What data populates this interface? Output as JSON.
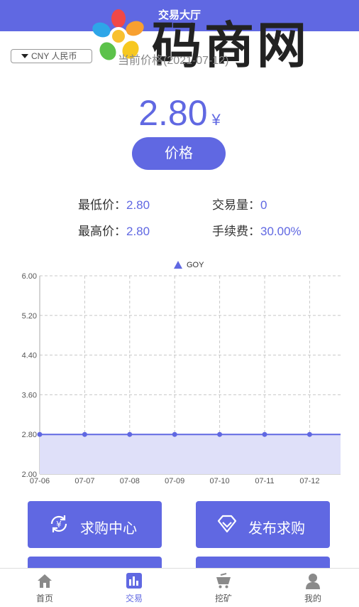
{
  "header": {
    "title": "交易大厅"
  },
  "watermark": {
    "text": "码商网"
  },
  "currency": {
    "selected": "CNY 人民币"
  },
  "price": {
    "date_label": "当前价格(2021-07-12)",
    "value": "2.80",
    "currency_symbol": "¥",
    "button_label": "价格"
  },
  "stats": {
    "low_label": "最低价：",
    "low_value": "2.80",
    "high_label": "最高价：",
    "high_value": "2.80",
    "volume_label": "交易量：",
    "volume_value": "0",
    "fee_label": "手续费：",
    "fee_value": "30.00%"
  },
  "chart_data": {
    "type": "area",
    "legend": [
      "GOY"
    ],
    "legend_position": "top-center",
    "categories": [
      "07-06",
      "07-07",
      "07-08",
      "07-09",
      "07-10",
      "07-11",
      "07-12"
    ],
    "series": [
      {
        "name": "GOY",
        "values": [
          2.8,
          2.8,
          2.8,
          2.8,
          2.8,
          2.8,
          2.8
        ]
      }
    ],
    "ylim": [
      2.0,
      6.0
    ],
    "yticks": [
      "6.00",
      "5.20",
      "4.40",
      "3.60",
      "2.80",
      "2.00"
    ],
    "grid": true,
    "line_color": "#6068e2",
    "fill_color": "#dfe0f9"
  },
  "actions": [
    {
      "label": "求购中心",
      "icon": "yen-cycle-icon"
    },
    {
      "label": "发布求购",
      "icon": "diamond-icon"
    }
  ],
  "tabs": [
    {
      "label": "首页",
      "icon": "home-icon"
    },
    {
      "label": "交易",
      "icon": "trade-chart-icon"
    },
    {
      "label": "挖矿",
      "icon": "mining-cart-icon"
    },
    {
      "label": "我的",
      "icon": "user-icon"
    }
  ],
  "colors": {
    "accent": "#6068e2",
    "background": "#ffffff"
  }
}
